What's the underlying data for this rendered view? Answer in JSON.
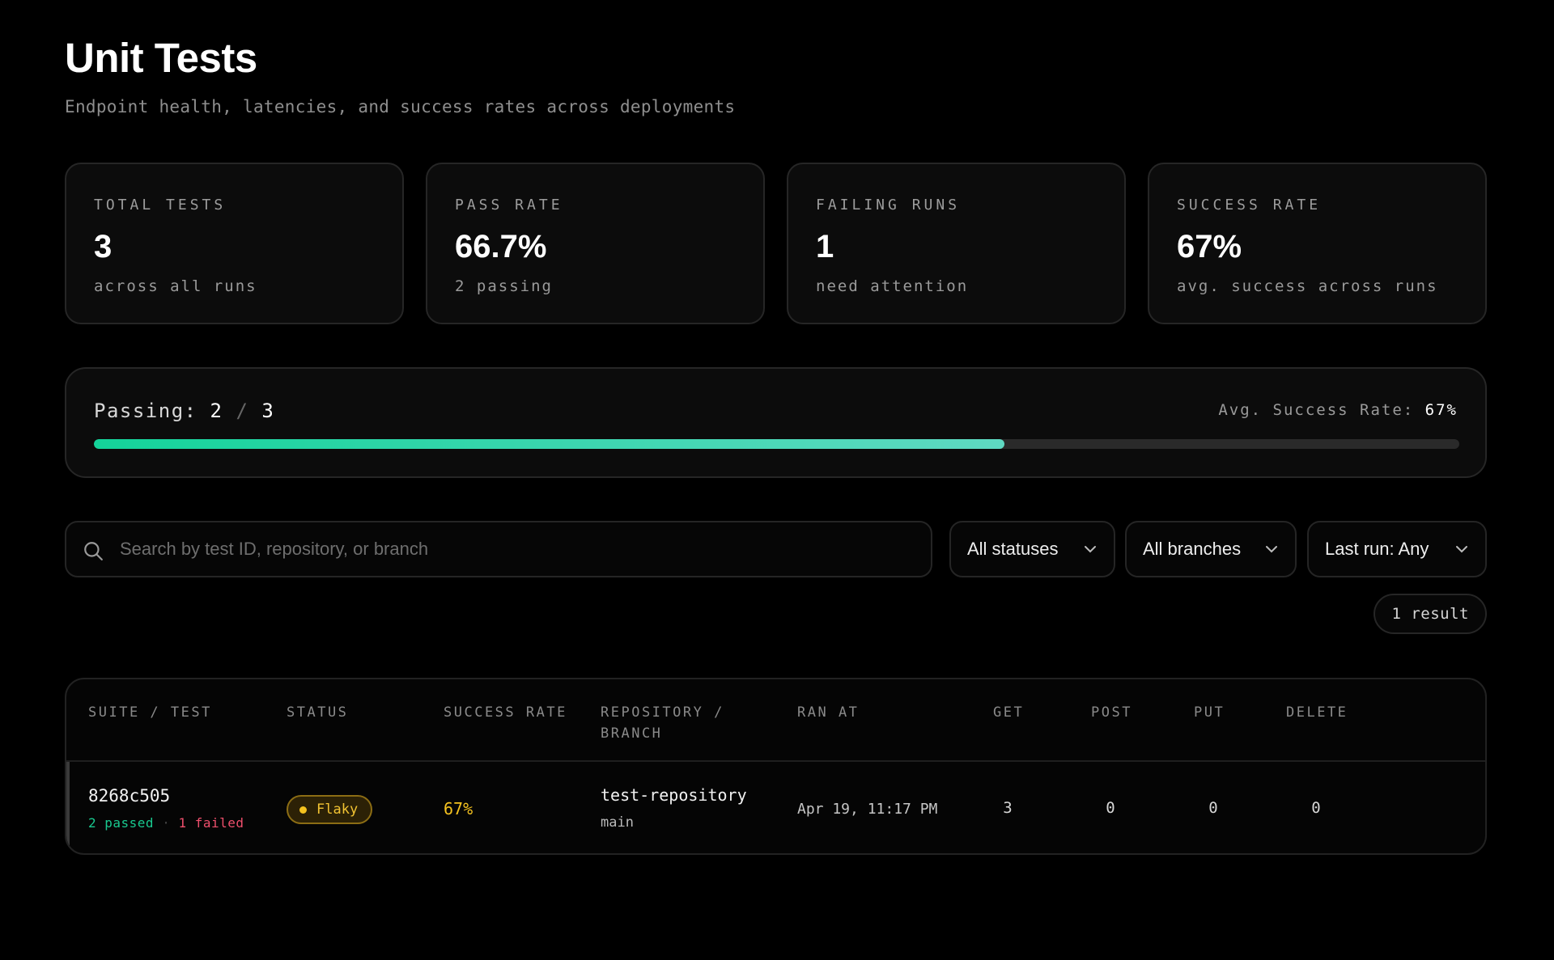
{
  "header": {
    "title": "Unit Tests",
    "subtitle": "Endpoint health, latencies, and success rates across deployments"
  },
  "stats": [
    {
      "label": "TOTAL TESTS",
      "value": "3",
      "sub": "across all runs"
    },
    {
      "label": "PASS RATE",
      "value": "66.7%",
      "sub": "2 passing"
    },
    {
      "label": "FAILING RUNS",
      "value": "1",
      "sub": "need attention"
    },
    {
      "label": "SUCCESS RATE",
      "value": "67%",
      "sub": "avg. success across runs"
    }
  ],
  "progress": {
    "passing_label": "Passing:",
    "passing_count": "2",
    "separator": "/",
    "total_count": "3",
    "avg_label": "Avg. Success Rate:",
    "avg_value": "67%",
    "fraction": 0.667,
    "fill_start": "#14d39a",
    "fill_end": "#5fd9c2"
  },
  "filters": {
    "search_placeholder": "Search by test ID, repository, or branch",
    "status": "All statuses",
    "branch": "All branches",
    "last_run": "Last run: Any",
    "result_count": "1 result"
  },
  "table": {
    "headers": {
      "suite": "SUITE / TEST",
      "status": "STATUS",
      "success_rate": "SUCCESS RATE",
      "repo_line1": "REPOSITORY /",
      "repo_line2": "BRANCH",
      "ran_at": "RAN AT",
      "get": "GET",
      "post": "POST",
      "put": "PUT",
      "delete": "DELETE"
    },
    "rows": [
      {
        "test_id": "8268c505",
        "passed": "2 passed",
        "dot": "·",
        "failed": "1 failed",
        "status": "Flaky",
        "status_color": "#f4c21f",
        "success_rate": "67%",
        "repository": "test-repository",
        "branch": "main",
        "ran_at": "Apr 19, 11:17 PM",
        "get": "3",
        "post": "0",
        "put": "0",
        "delete": "0"
      }
    ]
  }
}
